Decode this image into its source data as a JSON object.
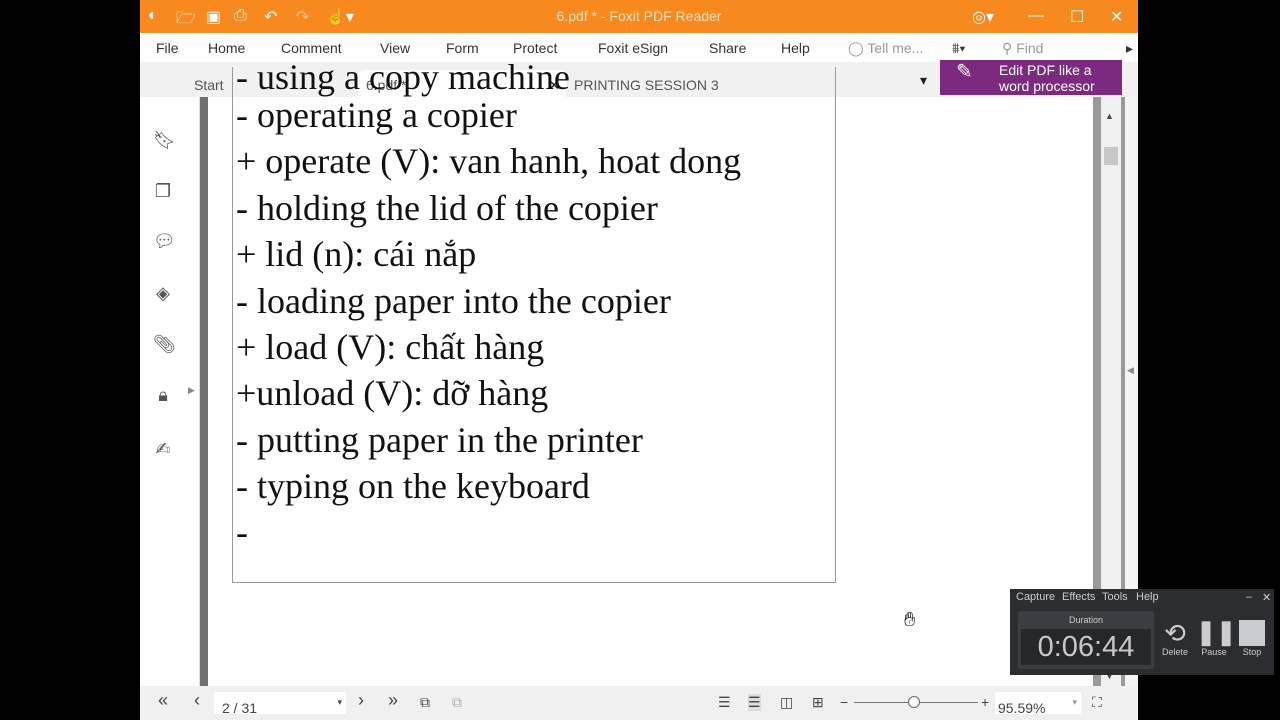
{
  "window": {
    "title": "6.pdf * - Foxit PDF Reader"
  },
  "menu": [
    "File",
    "Home",
    "Comment",
    "View",
    "Form",
    "Protect",
    "Foxit eSign",
    "Share",
    "Help"
  ],
  "tell_me_placeholder": "Tell me...",
  "find_placeholder": "Find",
  "tabs": [
    {
      "label": "Start"
    },
    {
      "label": "6.pdf *",
      "active": true
    },
    {
      "label": "PRINTING SESSION 3 -..."
    }
  ],
  "promo": {
    "line1": "Edit PDF like a",
    "line2": "word processor"
  },
  "document_lines": [
    "- using a copy machine",
    "- operating a copier",
    "+ operate (V): van hanh, hoat dong",
    "- holding the lid of the copier",
    "+ lid (n): cái nắp",
    "- loading paper into the copier",
    "+ load (V): chất hàng",
    "+unload (V): dỡ hàng",
    "- putting paper in the printer",
    "- typing on the keyboard",
    "-"
  ],
  "bottom": {
    "page": "2 / 31",
    "zoom": "95.59%",
    "zoom_level_percent": 95.59
  },
  "recorder": {
    "menu": [
      "Capture",
      "Effects",
      "Tools",
      "Help"
    ],
    "duration_label": "Duration",
    "duration": "0:06:44",
    "delete": "Delete",
    "pause": "Pause",
    "stop": "Stop"
  },
  "colors": {
    "title_bar": "#f7891f",
    "promo": "#7b2a7f"
  }
}
